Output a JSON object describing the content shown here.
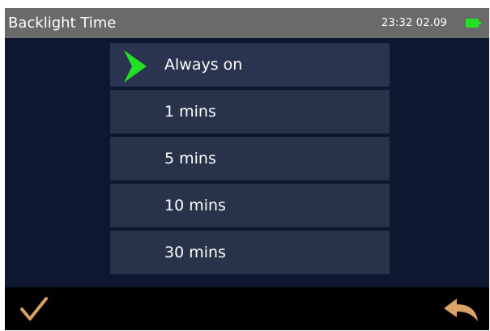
{
  "header": {
    "title": "Backlight Time",
    "time": "23:32 02.09"
  },
  "options": [
    {
      "label": "Always on",
      "selected": true
    },
    {
      "label": "1 mins",
      "selected": false
    },
    {
      "label": "5 mins",
      "selected": false
    },
    {
      "label": "10 mins",
      "selected": false
    },
    {
      "label": "30 mins",
      "selected": false
    }
  ],
  "icons": {
    "battery": "battery-icon",
    "pointer": "selection-arrow-icon",
    "confirm": "checkmark-icon",
    "back": "back-arrow-icon"
  },
  "colors": {
    "accent_green": "#22e022",
    "action_orange": "#d9a266",
    "background": "#0d1830",
    "option_bg": "#283248",
    "titlebar_bg": "#6a6a6a"
  }
}
